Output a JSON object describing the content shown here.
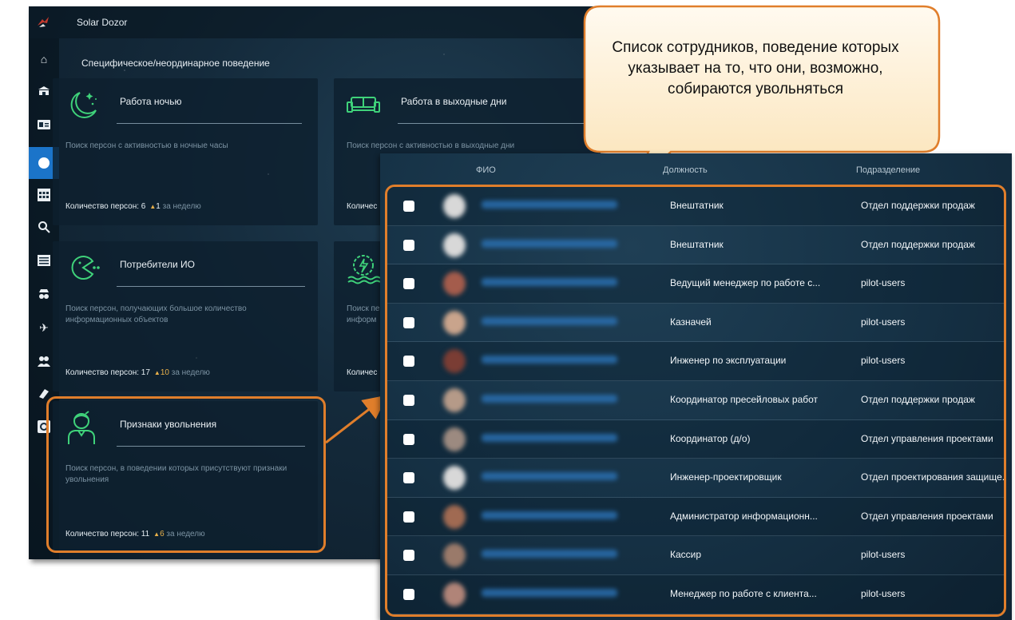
{
  "app": {
    "title": "Solar Dozor",
    "page_title": "Специфическое/неординарное поведение"
  },
  "sidebar": {
    "items": [
      {
        "icon": "home-icon"
      },
      {
        "icon": "bank-icon"
      },
      {
        "icon": "id-card-icon"
      },
      {
        "icon": "behavior-icon",
        "active": true
      },
      {
        "icon": "calendar-grid-icon"
      },
      {
        "icon": "search-icon"
      },
      {
        "icon": "list-icon"
      },
      {
        "icon": "spy-icon"
      },
      {
        "icon": "plane-icon"
      },
      {
        "icon": "users-icon"
      },
      {
        "icon": "eraser-icon"
      },
      {
        "icon": "settings-box-icon"
      }
    ]
  },
  "cards": [
    {
      "title": "Работа ночью",
      "description": "Поиск персон с активностью в ночные часы",
      "count_label": "Количество персон: 6",
      "delta": "1",
      "week": "за неделю",
      "icon": "moon-stars-icon"
    },
    {
      "title": "Работа в выходные дни",
      "description": "Поиск персон с активностью в выходные дни",
      "count_label": "Количес",
      "icon": "sofa-icon"
    },
    {
      "title": "Потребители ИО",
      "description": "Поиск персон, получающих большое количество информационных объектов",
      "count_label": "Количество персон: 17",
      "delta": "10",
      "week": "за неделю",
      "icon": "pacman-icon"
    },
    {
      "title": "",
      "description": "Поиск пе информ",
      "desc_line1": "Поиск пе",
      "desc_line2": "информ",
      "count_label": "Количес",
      "icon": "power-gear-icon"
    },
    {
      "title": "Признаки увольнения",
      "description": "Поиск персон, в поведении которых присутствуют признаки увольнения",
      "count_label": "Количество персон: 11",
      "delta": "6",
      "week": "за неделю",
      "icon": "person-leaving-icon"
    }
  ],
  "callout": {
    "text": "Список сотрудников, поведение которых указывает на то, что они, возможно, собираются увольняться"
  },
  "table": {
    "headers": {
      "fio": "ФИО",
      "position": "Должность",
      "department": "Подразделение"
    },
    "rows": [
      {
        "position": "Внештатник",
        "department": "Отдел поддержки продаж"
      },
      {
        "position": "Внештатник",
        "department": "Отдел поддержки продаж"
      },
      {
        "position": "Ведущий менеджер по работе с...",
        "department": "pilot-users"
      },
      {
        "position": "Казначей",
        "department": "pilot-users"
      },
      {
        "position": "Инженер по эксплуатации",
        "department": "pilot-users"
      },
      {
        "position": "Координатор пресейловых работ",
        "department": "Отдел поддержки продаж"
      },
      {
        "position": "Координатор (д/о)",
        "department": "Отдел управления проектами"
      },
      {
        "position": "Инженер-проектировщик",
        "department": "Отдел проектирования защище..."
      },
      {
        "position": "Администратор информационн...",
        "department": "Отдел управления проектами"
      },
      {
        "position": "Кассир",
        "department": "pilot-users"
      },
      {
        "position": "Менеджер по работе с клиента...",
        "department": "pilot-users"
      }
    ]
  },
  "colors": {
    "accent_orange": "#e07e2b",
    "icon_green": "#3fd27a",
    "active_blue": "#1b74c9",
    "delta_yellow": "#e8b04a"
  }
}
